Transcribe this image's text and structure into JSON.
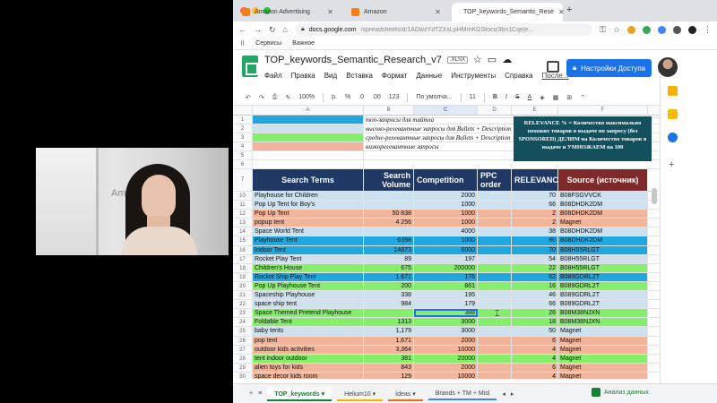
{
  "webcam": {
    "sign_text": "Amaz"
  },
  "browser": {
    "tabs": [
      {
        "label": "Amazon Advertising",
        "color": "#f57f17"
      },
      {
        "label": "Amazon",
        "color": "#f57f17"
      },
      {
        "label": "TOP_keywords_Semantic_Rese",
        "color": "#0f9d58"
      }
    ],
    "newtab": "+",
    "url_host": "docs.google.com",
    "url_path": "/spreadsheets/d/1ADwzYdTZXxLpHMmKGStociz3bn1Cqe|e...",
    "bookmarks": [
      "Сервисы",
      "Важное"
    ]
  },
  "doc": {
    "title": "TOP_keywords_Semantic_Research_v7",
    "badge": ".XLSX",
    "menus": [
      "Файл",
      "Правка",
      "Вид",
      "Вставка",
      "Формат",
      "Данные",
      "Инструменты",
      "Справка",
      "После..."
    ],
    "share_label": "Настройки Доступа"
  },
  "toolbar": {
    "zoom": "100%",
    "currency": "р.",
    "percent": "%",
    "dec1": ".0",
    "dec2": ".00",
    "format123": "123",
    "font": "По умолча...",
    "size": "11",
    "bold": "B",
    "italic": "I",
    "strike": "S",
    "textcolor": "A"
  },
  "formula": {
    "fx": "fx",
    "value": "388"
  },
  "grid": {
    "columns": [
      "A",
      "B",
      "C",
      "D",
      "E",
      "F"
    ],
    "legend": [
      {
        "row": "1",
        "color": "#1fa8e0",
        "text": "топ-запросы для тайтла"
      },
      {
        "row": "2",
        "color": "#cde1ef",
        "text": "высоко-релевантные запросы для Bullets + Description"
      },
      {
        "row": "3",
        "color": "#86ee6d",
        "text": "средне-релевантные запросы для Bullets + Description"
      },
      {
        "row": "4",
        "color": "#f2b49a",
        "text": "низкорелевантные запросы"
      },
      {
        "row": "5",
        "color": "",
        "text": ""
      },
      {
        "row": "6",
        "color": "",
        "text": ""
      }
    ],
    "relevance_box": "RELEVANCE % = Количество максимально похожих товаров в выдаче по запросу (без SPONSORED) ДЕЛИМ на Количество товаров в выдаче и УМНОЖАЕМ на 100",
    "header_row": "7",
    "headers": {
      "search_terms": "Search Terms",
      "search_volume": "Search Volume",
      "competition": "Competition",
      "ppc_order": "PPC order",
      "relevance": "RELEVANCE",
      "source": "Source (источник)"
    },
    "header_colors": {
      "dark": "#1f3864",
      "red": "#7f2a2a"
    },
    "rows": [
      {
        "n": "10",
        "term": "Playhouse for Children",
        "vol": "",
        "comp": "2000",
        "ppc": "",
        "rel": "70",
        "src": "B08FSGVVCK",
        "bg": "#cde1ef"
      },
      {
        "n": "11",
        "term": "Pop Up Tent for Boy's",
        "vol": "",
        "comp": "1000",
        "ppc": "",
        "rel": "66",
        "src": "B08DHDK2DM",
        "bg": "#cde1ef"
      },
      {
        "n": "12",
        "term": "Pop Up Tent",
        "vol": "50 838",
        "comp": "1000",
        "ppc": "",
        "rel": "2",
        "src": "B08DHDK2DM",
        "bg": "#f2b49a"
      },
      {
        "n": "13",
        "term": "popup tent",
        "vol": "4 256",
        "comp": "1000",
        "ppc": "",
        "rel": "2",
        "src": "Magnet",
        "bg": "#f2b49a"
      },
      {
        "n": "14",
        "term": "Space World Tent",
        "vol": "",
        "comp": "4000",
        "ppc": "",
        "rel": "38",
        "src": "B08DHDK2DM",
        "bg": "#cde1ef"
      },
      {
        "n": "15",
        "term": "Playhouse Tent",
        "vol": "6398",
        "comp": "1000",
        "ppc": "",
        "rel": "80",
        "src": "B08DHDK2DM",
        "bg": "#1fa8e0"
      },
      {
        "n": "16",
        "term": "Indoor Tent",
        "vol": "14873",
        "comp": "6000",
        "ppc": "",
        "rel": "70",
        "src": "B08H55RLGT",
        "bg": "#1fa8e0"
      },
      {
        "n": "17",
        "term": "Rocket Play Tent",
        "vol": "89",
        "comp": "197",
        "ppc": "",
        "rel": "54",
        "src": "B08H55RLGT",
        "bg": "#cde1ef"
      },
      {
        "n": "18",
        "term": "Children's House",
        "vol": "675",
        "comp": "200000",
        "ppc": "",
        "rel": "22",
        "src": "B08H55RLGT",
        "bg": "#86ee6d"
      },
      {
        "n": "19",
        "term": "Rocket Ship Play Tent",
        "vol": "1 671",
        "comp": "176",
        "ppc": "",
        "rel": "62",
        "src": "B089GDRL2T",
        "bg": "#1fa8e0"
      },
      {
        "n": "20",
        "term": "Pop Up Playhouse Tent",
        "vol": "200",
        "comp": "861",
        "ppc": "",
        "rel": "16",
        "src": "B089GDRL2T",
        "bg": "#86ee6d"
      },
      {
        "n": "21",
        "term": "Spaceship Playhouse",
        "vol": "338",
        "comp": "195",
        "ppc": "",
        "rel": "46",
        "src": "B089GDRL2T",
        "bg": "#cde1ef"
      },
      {
        "n": "22",
        "term": "space ship tent",
        "vol": "984",
        "comp": "179",
        "ppc": "",
        "rel": "66",
        "src": "B089GDRL2T",
        "bg": "#cde1ef"
      },
      {
        "n": "23",
        "term": "Space Themed Pretend Playhouse",
        "vol": "",
        "comp": "388",
        "ppc": "",
        "rel": "26",
        "src": "B08M38NJXN",
        "bg": "#86ee6d",
        "selected": true
      },
      {
        "n": "24",
        "term": "Foldable Tent",
        "vol": "1313",
        "comp": "3000",
        "ppc": "",
        "rel": "18",
        "src": "B08M38NJXN",
        "bg": "#86ee6d"
      },
      {
        "n": "25",
        "term": "baby tents",
        "vol": "1,179",
        "comp": "3000",
        "ppc": "",
        "rel": "50",
        "src": "Magnet",
        "bg": "#cde1ef"
      },
      {
        "n": "26",
        "term": "pop tent",
        "vol": "1,671",
        "comp": "2000",
        "ppc": "",
        "rel": "6",
        "src": "Magnet",
        "bg": "#f2b49a"
      },
      {
        "n": "27",
        "term": "outdoor kids activities",
        "vol": "3,364",
        "comp": "10000",
        "ppc": "",
        "rel": "4",
        "src": "Magnet",
        "bg": "#f2b49a"
      },
      {
        "n": "28",
        "term": "tent indoor outdoor",
        "vol": "381",
        "comp": "20000",
        "ppc": "",
        "rel": "4",
        "src": "Magnet",
        "bg": "#86ee6d"
      },
      {
        "n": "29",
        "term": "alien toys for kids",
        "vol": "843",
        "comp": "2000",
        "ppc": "",
        "rel": "6",
        "src": "Magnet",
        "bg": "#f2b49a"
      },
      {
        "n": "30",
        "term": "space decor kids room",
        "vol": "129",
        "comp": "10000",
        "ppc": "",
        "rel": "4",
        "src": "Magnet",
        "bg": "#f2b49a"
      }
    ]
  },
  "sheettabs": {
    "add": "+",
    "list": "≡",
    "tabs": [
      {
        "label": "TOP_keywords",
        "active": true,
        "color": "#188038"
      },
      {
        "label": "Helium10",
        "active": false,
        "color": "#f4b400"
      },
      {
        "label": "Ideas",
        "active": false,
        "color": "#e8710a"
      },
      {
        "label": "Brands + TM + Misl",
        "active": false,
        "color": "#4285f4"
      }
    ],
    "explore": "Анализ данных"
  }
}
